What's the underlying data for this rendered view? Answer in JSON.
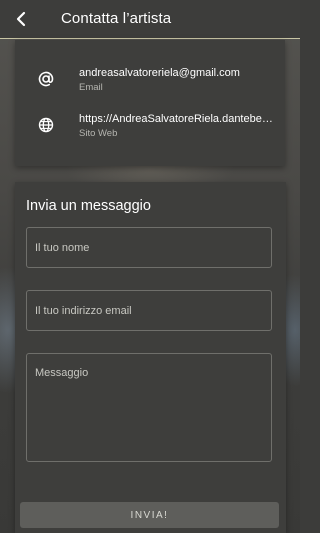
{
  "header": {
    "title": "Contatta l’artista",
    "back_icon": "back-arrow-icon"
  },
  "contacts": [
    {
      "icon": "at-sign-icon",
      "value": "andreasalvatoreriela@gmail.com",
      "label": "Email"
    },
    {
      "icon": "globe-icon",
      "value": "https://AndreaSalvatoreRiela.dantebea.com",
      "label": "Sito Web"
    }
  ],
  "form": {
    "title": "Invia un messaggio",
    "name_placeholder": "Il tuo nome",
    "email_placeholder": "Il tuo indirizzo email",
    "message_placeholder": "Messaggio",
    "send_label": "INVIA!"
  },
  "colors": {
    "header_divider": "#c9c6a5",
    "card_background": "#3e3e3c",
    "send_button": "#5e5e5b"
  }
}
